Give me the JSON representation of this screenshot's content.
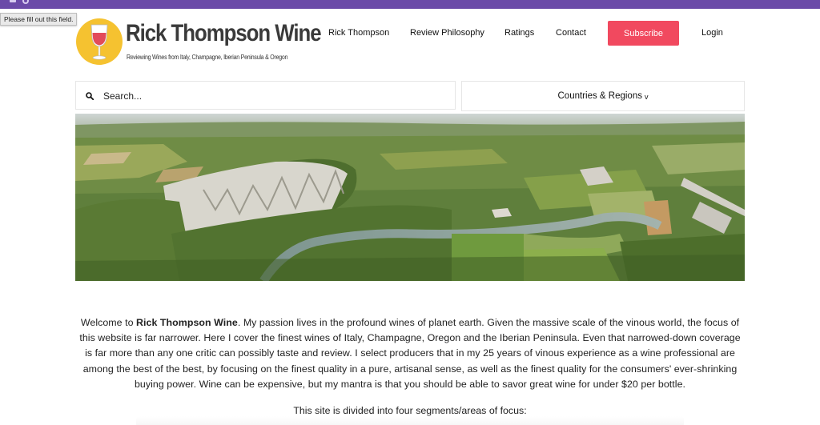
{
  "browser": {
    "tooltip": "Please fill out this field."
  },
  "brand": {
    "title": "Rick Thompson Wine",
    "tagline": "Reviewing Wines from Italy, Champagne, Iberian Peninsula & Oregon",
    "logo_icon": "wine-glass-icon",
    "logo_color": "#f5c230",
    "wine_color": "#e24b5a"
  },
  "nav": {
    "items": [
      {
        "label": "Rick Thompson"
      },
      {
        "label": "Review Philosophy"
      },
      {
        "label": "Ratings"
      },
      {
        "label": "Contact"
      }
    ],
    "subscribe_label": "Subscribe",
    "login_label": "Login",
    "accent": "#f1495f"
  },
  "search": {
    "placeholder": "Search...",
    "value": ""
  },
  "regions": {
    "label": "Countries & Regions",
    "chevron": "v"
  },
  "content": {
    "welcome_prefix": "Welcome to ",
    "welcome_bold": "Rick Thompson Wine",
    "welcome_rest": ". My passion lives in the profound wines of planet earth. Given the massive scale of the vinous world, the focus of this website is far narrower. Here I cover the finest wines of Italy, Champagne, Oregon and the Iberian Peninsula. Even that narrowed-down coverage is far more than any one critic can possibly taste and review. I select producers that in my 25 years of vinous experience as a wine professional are among the best of the best, by focusing on the finest quality in a pure, artisanal sense, as well as the finest quality for the consumers' ever-shrinking buying power. Wine can be expensive, but my mantra is that you should be able to savor great wine for under $20 per bottle.",
    "divided": "This site is divided into four segments/areas of focus:"
  }
}
